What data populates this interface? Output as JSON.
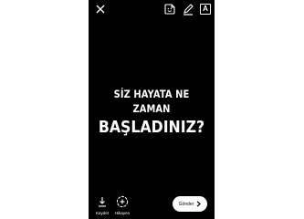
{
  "story_editor": {
    "caption_line1": "SİZ HAYATA NE ZAMAN",
    "caption_line2": "BAŞLADINIZ?",
    "top_tools": {
      "sticker_icon": "sticker-icon",
      "draw_icon": "pen-icon",
      "text_icon": "text-icon",
      "text_glyph": "A"
    },
    "save_label": "Kaydet",
    "story_label": "Hikayen",
    "send_label": "Gönder",
    "background_color": "#000000",
    "text_color": "#ffffff"
  }
}
